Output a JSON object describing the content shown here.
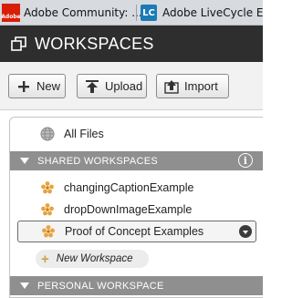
{
  "browser": {
    "tabs": [
      {
        "label": "Adobe Community: ...",
        "favicon": "adobe-favicon"
      },
      {
        "label": "Adobe LiveCycle ES...",
        "favicon": "livecycle-favicon",
        "favicon_text": "LC"
      }
    ]
  },
  "header": {
    "title": "WORKSPACES",
    "icon": "workspaces-icon"
  },
  "toolbar": {
    "new_label": "New",
    "upload_label": "Upload",
    "import_label": "Import"
  },
  "panel": {
    "all_files": "All Files",
    "shared_section": "SHARED WORKSPACES",
    "shared_items": [
      {
        "label": "changingCaptionExample"
      },
      {
        "label": "dropDownImageExample"
      },
      {
        "label": "Proof of Concept Examples",
        "selected": true
      }
    ],
    "new_workspace": "New Workspace",
    "personal_section": "PERSONAL WORKSPACE"
  },
  "colors": {
    "header_bg": "#2e2e2e",
    "section_bg": "#8f8f8f",
    "workspace_icon": "#e8a33a"
  }
}
